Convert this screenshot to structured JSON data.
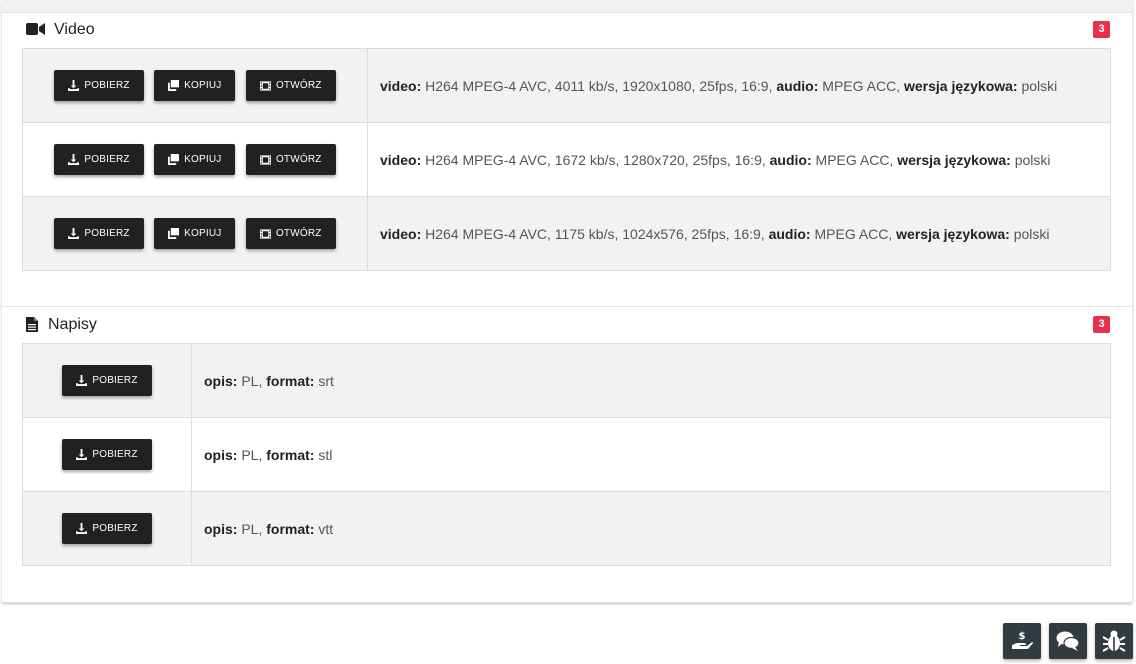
{
  "video": {
    "title": "Video",
    "count": "3",
    "buttons": {
      "download": "POBIERZ",
      "copy": "KOPIUJ",
      "open": "OTWÓRZ"
    },
    "labels": {
      "video": "video:",
      "audio": "audio:",
      "language": "wersja językowa:"
    },
    "rows": [
      {
        "video": "H264 MPEG-4 AVC, 4011 kb/s, 1920x1080, 25fps, 16:9,",
        "audio": "MPEG ACC,",
        "language": "polski"
      },
      {
        "video": "H264 MPEG-4 AVC, 1672 kb/s, 1280x720, 25fps, 16:9,",
        "audio": "MPEG ACC,",
        "language": "polski"
      },
      {
        "video": "H264 MPEG-4 AVC, 1175 kb/s, 1024x576, 25fps, 16:9,",
        "audio": "MPEG ACC,",
        "language": "polski"
      }
    ]
  },
  "subtitles": {
    "title": "Napisy",
    "count": "3",
    "download_label": "POBIERZ",
    "labels": {
      "description": "opis:",
      "format": "format:"
    },
    "rows": [
      {
        "description": "PL,",
        "format": "srt"
      },
      {
        "description": "PL,",
        "format": "stl"
      },
      {
        "description": "PL,",
        "format": "vtt"
      }
    ]
  },
  "floating_buttons": [
    {
      "icon": "donate-icon"
    },
    {
      "icon": "chat-icon"
    },
    {
      "icon": "bug-icon"
    }
  ],
  "colors": {
    "badge": "#e8304b",
    "button": "#212121",
    "floating": "#313b40"
  }
}
